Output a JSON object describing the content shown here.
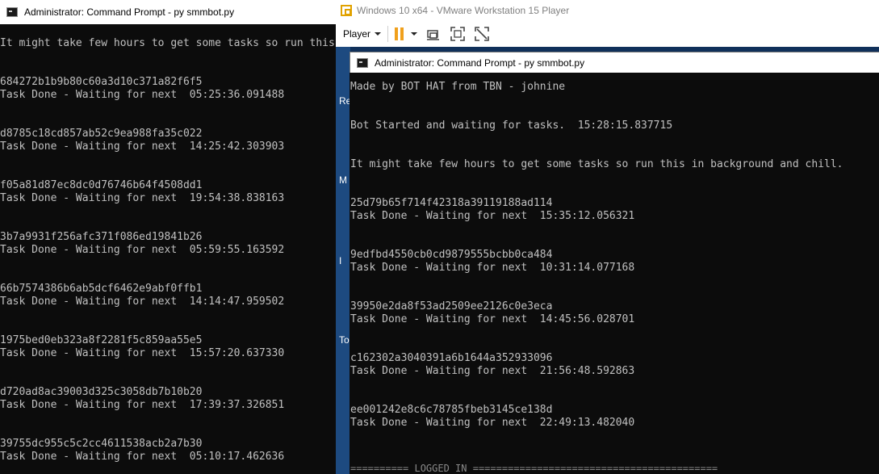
{
  "left_window": {
    "title": "Administrator: Command Prompt - py  smmbot.py",
    "partial_line": "It might take few hours to get some tasks so run this",
    "entries": [
      {
        "hash": "684272b1b9b80c60a3d10c371a82f6f5",
        "status": "Task Done - Waiting for next  05:25:36.091488"
      },
      {
        "hash": "d8785c18cd857ab52c9ea988fa35c022",
        "status": "Task Done - Waiting for next  14:25:42.303903"
      },
      {
        "hash": "f05a81d87ec8dc0d76746b64f4508dd1",
        "status": "Task Done - Waiting for next  19:54:38.838163"
      },
      {
        "hash": "3b7a9931f256afc371f086ed19841b26",
        "status": "Task Done - Waiting for next  05:59:55.163592"
      },
      {
        "hash": "66b7574386b6ab5dcf6462e9abf0ffb1",
        "status": "Task Done - Waiting for next  14:14:47.959502"
      },
      {
        "hash": "1975bed0eb323a8f2281f5c859aa55e5",
        "status": "Task Done - Waiting for next  15:57:20.637330"
      },
      {
        "hash": "d720ad8ac39003d325c3058db7b10b20",
        "status": "Task Done - Waiting for next  17:39:37.326851"
      },
      {
        "hash": "39755dc955c5c2cc4611538acb2a7b30",
        "status": "Task Done - Waiting for next  05:10:17.462636"
      }
    ]
  },
  "vmware": {
    "title": "Windows 10 x64 - VMware Workstation 15 Player",
    "player_menu": "Player",
    "icons": {
      "app": "vmware-icon",
      "pause": "pause-icon",
      "send_keys": "send-ctrl-alt-del-icon",
      "fullscreen": "fullscreen-icon",
      "unity": "unity-icon"
    },
    "accent_color": "#f0a01c"
  },
  "guest": {
    "desktop_text_fragments": [
      "Re",
      "M",
      "I",
      "To"
    ],
    "inner_window": {
      "title": "Administrator: Command Prompt - py  smmbot.py",
      "lines": [
        "Made by BOT HAT from TBN - johnine",
        "Bot Started and waiting for tasks.  15:28:15.837715",
        "It might take few hours to get some tasks so run this in background and chill."
      ],
      "entries": [
        {
          "hash": "25d79b65f714f42318a39119188ad114",
          "status": "Task Done - Waiting for next  15:35:12.056321"
        },
        {
          "hash": "9edfbd4550cb0cd9879555bcbb0ca484",
          "status": "Task Done - Waiting for next  10:31:14.077168"
        },
        {
          "hash": "39950e2da8f53ad2509ee2126c0e3eca",
          "status": "Task Done - Waiting for next  14:45:56.028701"
        },
        {
          "hash": "c162302a3040391a6b1644a352933096",
          "status": "Task Done - Waiting for next  21:56:48.592863"
        },
        {
          "hash": "ee001242e8c6c78785fbeb3145ce138d",
          "status": "Task Done - Waiting for next  22:49:13.482040"
        }
      ],
      "bottom_partial": "========== LOGGED IN =========================================="
    }
  }
}
